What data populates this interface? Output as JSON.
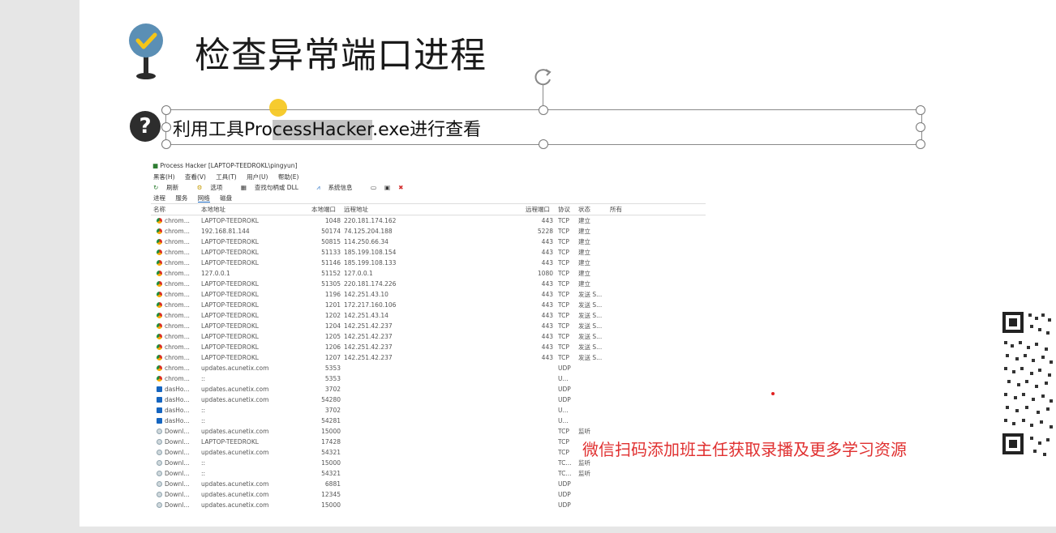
{
  "slide": {
    "title": "检查异常端口进程",
    "subtitle_before": "利用工具Pro",
    "subtitle_highlight": "cessHacker",
    "subtitle_after": ".exe进行查看",
    "question_icon_char": "?",
    "promo_text": "微信扫码添加班主任获取录播及更多学习资源",
    "promo_color": "#e03030"
  },
  "process_hacker": {
    "window_title": "Process Hacker [LAPTOP-TEEDROKL\\pingyun]",
    "menu": [
      "黑客(H)",
      "查看(V)",
      "工具(T)",
      "用户(U)",
      "帮助(E)"
    ],
    "toolbar": [
      "刷新",
      "选项",
      "查找句柄或 DLL",
      "系统信息"
    ],
    "tabs": [
      "进程",
      "服务",
      "网络",
      "磁盘"
    ],
    "columns": [
      "名称",
      "本地地址",
      "本地端口",
      "远程地址",
      "远程端口",
      "协议",
      "状态",
      "所有"
    ],
    "rows": [
      {
        "icon": "chrome",
        "name": "chrom...",
        "local": "LAPTOP-TEEDROKL",
        "lport": "1048",
        "remote": "220.181.174.162",
        "rport": "443",
        "proto": "TCP",
        "state": "建立"
      },
      {
        "icon": "chrome",
        "name": "chrom...",
        "local": "192.168.81.144",
        "lport": "50174",
        "remote": "74.125.204.188",
        "rport": "5228",
        "proto": "TCP",
        "state": "建立"
      },
      {
        "icon": "chrome",
        "name": "chrom...",
        "local": "LAPTOP-TEEDROKL",
        "lport": "50815",
        "remote": "114.250.66.34",
        "rport": "443",
        "proto": "TCP",
        "state": "建立"
      },
      {
        "icon": "chrome",
        "name": "chrom...",
        "local": "LAPTOP-TEEDROKL",
        "lport": "51133",
        "remote": "185.199.108.154",
        "rport": "443",
        "proto": "TCP",
        "state": "建立"
      },
      {
        "icon": "chrome",
        "name": "chrom...",
        "local": "LAPTOP-TEEDROKL",
        "lport": "51146",
        "remote": "185.199.108.133",
        "rport": "443",
        "proto": "TCP",
        "state": "建立"
      },
      {
        "icon": "chrome",
        "name": "chrom...",
        "local": "127.0.0.1",
        "lport": "51152",
        "remote": "127.0.0.1",
        "rport": "1080",
        "proto": "TCP",
        "state": "建立"
      },
      {
        "icon": "chrome",
        "name": "chrom...",
        "local": "LAPTOP-TEEDROKL",
        "lport": "51305",
        "remote": "220.181.174.226",
        "rport": "443",
        "proto": "TCP",
        "state": "建立"
      },
      {
        "icon": "chrome",
        "name": "chrom...",
        "local": "LAPTOP-TEEDROKL",
        "lport": "1196",
        "remote": "142.251.43.10",
        "rport": "443",
        "proto": "TCP",
        "state": "发送 S..."
      },
      {
        "icon": "chrome",
        "name": "chrom...",
        "local": "LAPTOP-TEEDROKL",
        "lport": "1201",
        "remote": "172.217.160.106",
        "rport": "443",
        "proto": "TCP",
        "state": "发送 S..."
      },
      {
        "icon": "chrome",
        "name": "chrom...",
        "local": "LAPTOP-TEEDROKL",
        "lport": "1202",
        "remote": "142.251.43.14",
        "rport": "443",
        "proto": "TCP",
        "state": "发送 S..."
      },
      {
        "icon": "chrome",
        "name": "chrom...",
        "local": "LAPTOP-TEEDROKL",
        "lport": "1204",
        "remote": "142.251.42.237",
        "rport": "443",
        "proto": "TCP",
        "state": "发送 S..."
      },
      {
        "icon": "chrome",
        "name": "chrom...",
        "local": "LAPTOP-TEEDROKL",
        "lport": "1205",
        "remote": "142.251.42.237",
        "rport": "443",
        "proto": "TCP",
        "state": "发送 S..."
      },
      {
        "icon": "chrome",
        "name": "chrom...",
        "local": "LAPTOP-TEEDROKL",
        "lport": "1206",
        "remote": "142.251.42.237",
        "rport": "443",
        "proto": "TCP",
        "state": "发送 S..."
      },
      {
        "icon": "chrome",
        "name": "chrom...",
        "local": "LAPTOP-TEEDROKL",
        "lport": "1207",
        "remote": "142.251.42.237",
        "rport": "443",
        "proto": "TCP",
        "state": "发送 S..."
      },
      {
        "icon": "chrome",
        "name": "chrom...",
        "local": "updates.acunetix.com",
        "lport": "5353",
        "remote": "",
        "rport": "",
        "proto": "UDP",
        "state": ""
      },
      {
        "icon": "chrome",
        "name": "chrom...",
        "local": "::",
        "lport": "5353",
        "remote": "",
        "rport": "",
        "proto": "U...",
        "state": ""
      },
      {
        "icon": "app",
        "name": "dasHo...",
        "local": "updates.acunetix.com",
        "lport": "3702",
        "remote": "",
        "rport": "",
        "proto": "UDP",
        "state": ""
      },
      {
        "icon": "app",
        "name": "dasHo...",
        "local": "updates.acunetix.com",
        "lport": "54280",
        "remote": "",
        "rport": "",
        "proto": "UDP",
        "state": ""
      },
      {
        "icon": "app",
        "name": "dasHo...",
        "local": "::",
        "lport": "3702",
        "remote": "",
        "rport": "",
        "proto": "U...",
        "state": ""
      },
      {
        "icon": "app",
        "name": "dasHo...",
        "local": "::",
        "lport": "54281",
        "remote": "",
        "rport": "",
        "proto": "U...",
        "state": ""
      },
      {
        "icon": "dl",
        "name": "Downl...",
        "local": "updates.acunetix.com",
        "lport": "15000",
        "remote": "",
        "rport": "",
        "proto": "TCP",
        "state": "监听"
      },
      {
        "icon": "dl",
        "name": "Downl...",
        "local": "LAPTOP-TEEDROKL",
        "lport": "17428",
        "remote": "",
        "rport": "",
        "proto": "TCP",
        "state": ""
      },
      {
        "icon": "dl",
        "name": "Downl...",
        "local": "updates.acunetix.com",
        "lport": "54321",
        "remote": "",
        "rport": "",
        "proto": "TCP",
        "state": ""
      },
      {
        "icon": "dl",
        "name": "Downl...",
        "local": "::",
        "lport": "15000",
        "remote": "",
        "rport": "",
        "proto": "TC...",
        "state": "监听"
      },
      {
        "icon": "dl",
        "name": "Downl...",
        "local": "::",
        "lport": "54321",
        "remote": "",
        "rport": "",
        "proto": "TC...",
        "state": "监听"
      },
      {
        "icon": "dl",
        "name": "Downl...",
        "local": "updates.acunetix.com",
        "lport": "6881",
        "remote": "",
        "rport": "",
        "proto": "UDP",
        "state": ""
      },
      {
        "icon": "dl",
        "name": "Downl...",
        "local": "updates.acunetix.com",
        "lport": "12345",
        "remote": "",
        "rport": "",
        "proto": "UDP",
        "state": ""
      },
      {
        "icon": "dl",
        "name": "Downl...",
        "local": "updates.acunetix.com",
        "lport": "15000",
        "remote": "",
        "rport": "",
        "proto": "UDP",
        "state": ""
      }
    ]
  }
}
